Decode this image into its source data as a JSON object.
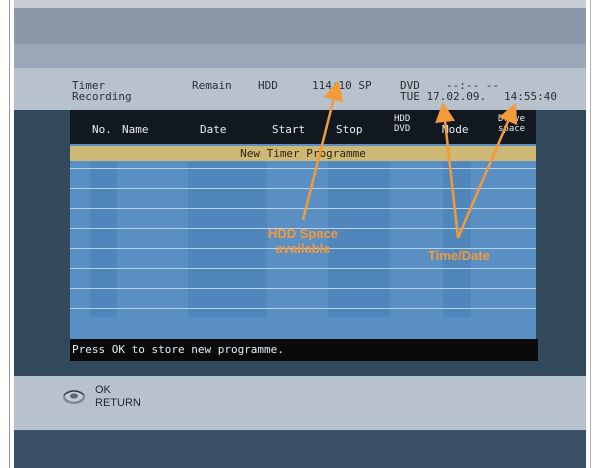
{
  "header": {
    "title_line1": "Timer",
    "title_line2": "Recording",
    "remain_label": "Remain",
    "hdd_label": "HDD",
    "hdd_space": "114:10 SP",
    "dvd_label": "DVD",
    "dvd_value": "--:-- --",
    "date_value": "TUE 17.02.09.",
    "time_value": "14:55:40"
  },
  "table": {
    "columns": {
      "no": "No.",
      "name": "Name",
      "date": "Date",
      "start": "Start",
      "stop": "Stop",
      "hdd_line": "HDD",
      "dvd_line": "DVD",
      "mode": "Mode",
      "drive_line1": "Drive",
      "drive_line2": "space"
    },
    "new_programme_label": "New Timer Programme"
  },
  "status_message": "Press OK to store new programme.",
  "footer": {
    "ok_label": "OK",
    "return_label": "RETURN"
  },
  "annotations": {
    "hdd_space_line1": "HDD Space",
    "hdd_space_line2": "available",
    "time_date": "Time/Date"
  },
  "icons": {
    "remote_dial": "remote-dial-icon"
  },
  "colors": {
    "annotation": "#f39a3b",
    "table_blue": "#5a8fc3",
    "new_row": "#cdb876"
  }
}
